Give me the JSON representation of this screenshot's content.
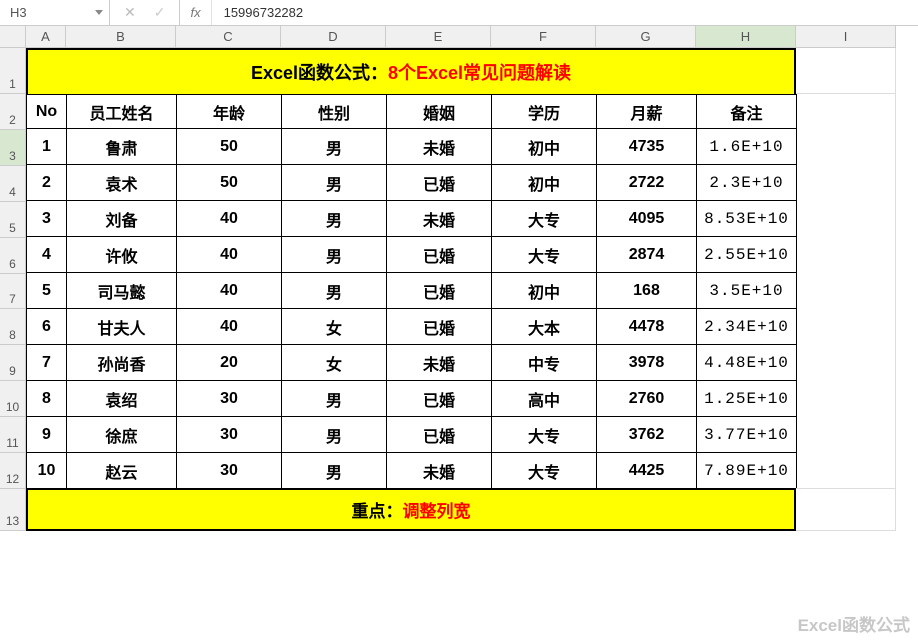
{
  "formula_bar": {
    "name_box": "H3",
    "fx_label": "fx",
    "formula_value": "15996732282"
  },
  "columns": [
    "A",
    "B",
    "C",
    "D",
    "E",
    "F",
    "G",
    "H",
    "I"
  ],
  "row_numbers": [
    "1",
    "2",
    "3",
    "4",
    "5",
    "6",
    "7",
    "8",
    "9",
    "10",
    "11",
    "12",
    "13"
  ],
  "title": {
    "prefix": "Excel函数公式：",
    "main": "8个Excel常见问题解读"
  },
  "headers": {
    "no": "No",
    "name": "员工姓名",
    "age": "年龄",
    "sex": "性别",
    "marriage": "婚姻",
    "education": "学历",
    "salary": "月薪",
    "remark": "备注"
  },
  "rows": [
    {
      "no": "1",
      "name": "鲁肃",
      "age": "50",
      "sex": "男",
      "mar": "未婚",
      "edu": "初中",
      "sal": "4735",
      "rem": "1.6E+10"
    },
    {
      "no": "2",
      "name": "袁术",
      "age": "50",
      "sex": "男",
      "mar": "已婚",
      "edu": "初中",
      "sal": "2722",
      "rem": "2.3E+10"
    },
    {
      "no": "3",
      "name": "刘备",
      "age": "40",
      "sex": "男",
      "mar": "未婚",
      "edu": "大专",
      "sal": "4095",
      "rem": "8.53E+10"
    },
    {
      "no": "4",
      "name": "许攸",
      "age": "40",
      "sex": "男",
      "mar": "已婚",
      "edu": "大专",
      "sal": "2874",
      "rem": "2.55E+10"
    },
    {
      "no": "5",
      "name": "司马懿",
      "age": "40",
      "sex": "男",
      "mar": "已婚",
      "edu": "初中",
      "sal": "168",
      "rem": "3.5E+10"
    },
    {
      "no": "6",
      "name": "甘夫人",
      "age": "40",
      "sex": "女",
      "mar": "已婚",
      "edu": "大本",
      "sal": "4478",
      "rem": "2.34E+10"
    },
    {
      "no": "7",
      "name": "孙尚香",
      "age": "20",
      "sex": "女",
      "mar": "未婚",
      "edu": "中专",
      "sal": "3978",
      "rem": "4.48E+10"
    },
    {
      "no": "8",
      "name": "袁绍",
      "age": "30",
      "sex": "男",
      "mar": "已婚",
      "edu": "高中",
      "sal": "2760",
      "rem": "1.25E+10"
    },
    {
      "no": "9",
      "name": "徐庶",
      "age": "30",
      "sex": "男",
      "mar": "已婚",
      "edu": "大专",
      "sal": "3762",
      "rem": "3.77E+10"
    },
    {
      "no": "10",
      "name": "赵云",
      "age": "30",
      "sex": "男",
      "mar": "未婚",
      "edu": "大专",
      "sal": "4425",
      "rem": "7.89E+10"
    }
  ],
  "footer": {
    "prefix": "重点：",
    "main": "调整列宽"
  },
  "watermark": "Excel函数公式",
  "selected": {
    "col": "H",
    "row": "3"
  }
}
